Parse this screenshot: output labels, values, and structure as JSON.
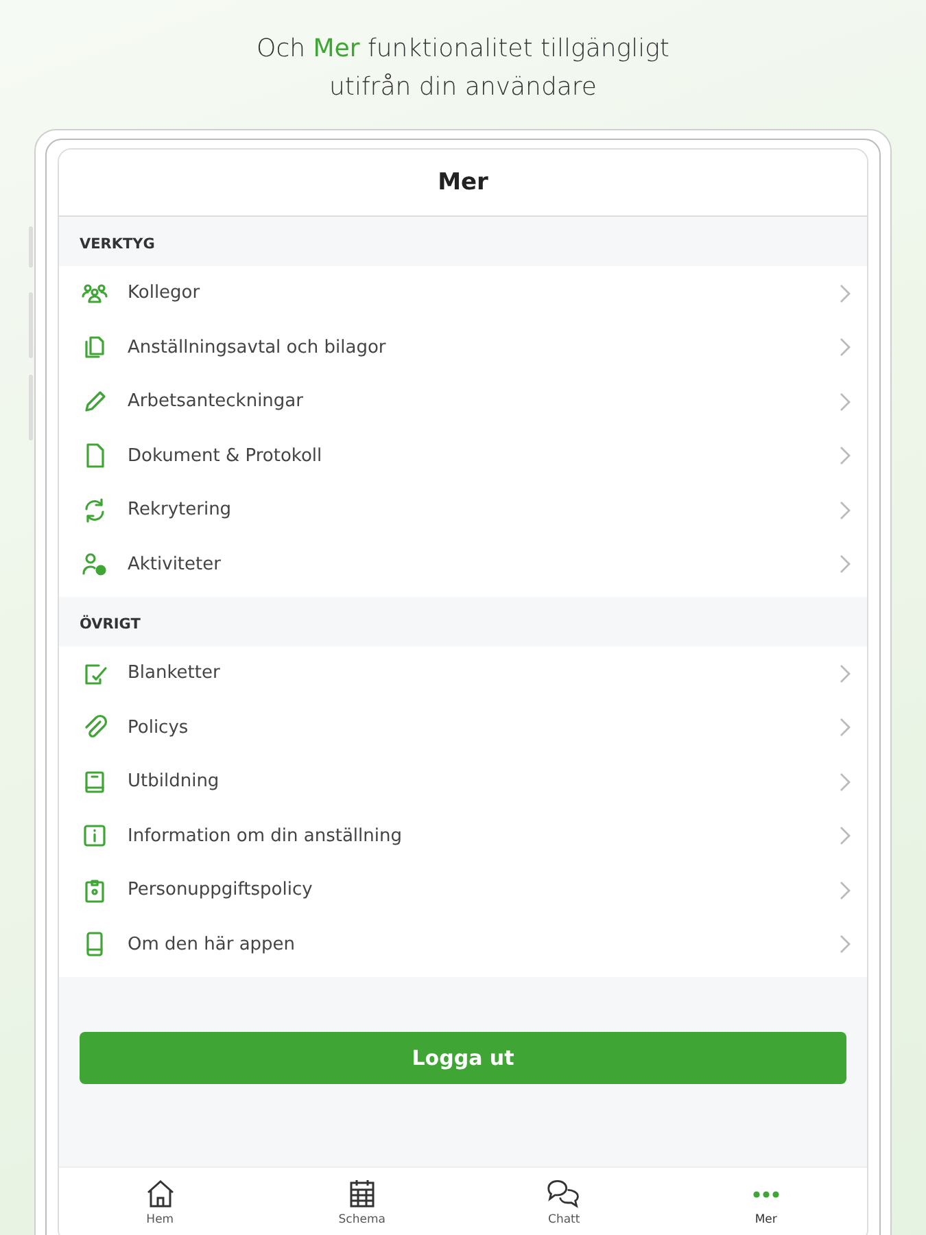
{
  "headline": "Och **Mer** funktionalitet tillgängligt utifrån din användare",
  "screen": {
    "title": "Mer",
    "sections": [
      {
        "heading": "VERKTYG",
        "items": [
          "Kollegor",
          "Anställningsavtal och bilagor",
          "Arbetsanteckningar",
          "Dokument & Protokoll",
          "Rekrytering",
          "Aktiviteter"
        ]
      },
      {
        "heading": "ÖVRIGT",
        "items": [
          "Blanketter",
          "Policys",
          "Utbildning",
          "Information om din anställning",
          "Personuppgiftspolicy",
          "Om den här appen"
        ]
      }
    ],
    "logout_button": "Logga ut",
    "tabs": [
      {
        "label": "Hem",
        "selected": false
      },
      {
        "label": "Schema",
        "selected": false
      },
      {
        "label": "Chatt",
        "selected": false
      },
      {
        "label": "Mer",
        "selected": true
      }
    ]
  }
}
